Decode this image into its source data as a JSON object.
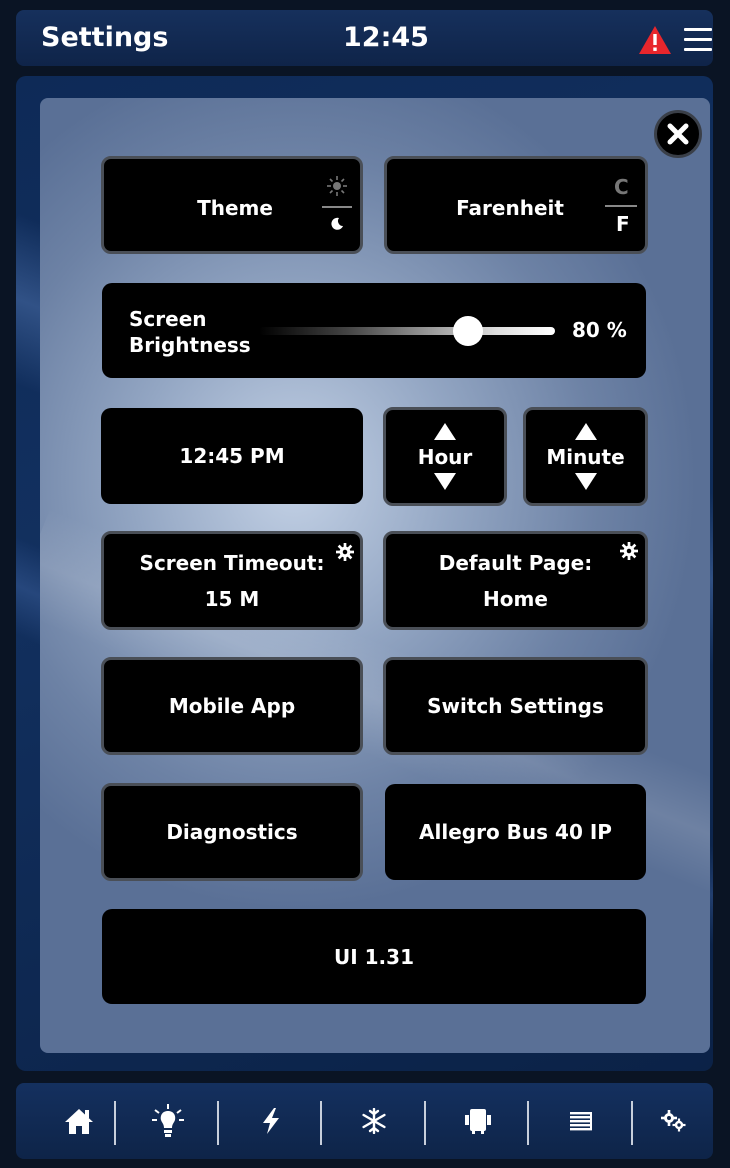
{
  "header": {
    "title": "Settings",
    "clock": "12:45",
    "icons": {
      "warning": "warning-triangle-icon",
      "menu": "hamburger-menu-icon"
    },
    "warning_color": "#e8262c"
  },
  "settings": {
    "theme_label": "Theme",
    "temp_unit_label": "Farenheit",
    "temp_toggle_top": "C",
    "temp_toggle_bottom": "F",
    "brightness_label_line1": "Screen",
    "brightness_label_line2": "Brightness",
    "brightness_value": 80,
    "brightness_display": "80 %",
    "time_display": "12:45 PM",
    "hour_label": "Hour",
    "minute_label": "Minute",
    "screen_timeout_label": "Screen Timeout:",
    "screen_timeout_value": "15 M",
    "default_page_label": "Default Page:",
    "default_page_value": "Home",
    "mobile_app_label": "Mobile App",
    "switch_settings_label": "Switch Settings",
    "diagnostics_label": "Diagnostics",
    "device_label": "Allegro Bus 40 IP",
    "version_label": "UI 1.31"
  },
  "nav": {
    "items": [
      "home-icon",
      "lightbulb-icon",
      "lightning-icon",
      "snowflake-icon",
      "device-icon",
      "shades-icon",
      "settings-gears-icon"
    ]
  }
}
